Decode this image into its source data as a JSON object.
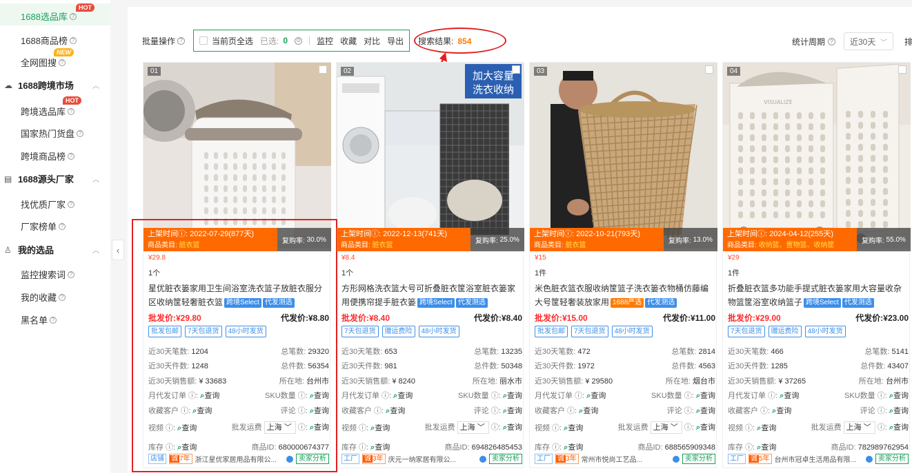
{
  "sidebar": {
    "items": [
      {
        "label": "1688选品库",
        "badge": "HOT",
        "active": true
      },
      {
        "label": "1688商品榜"
      },
      {
        "label": "全网图搜",
        "badge": "NEW"
      },
      {
        "group": "1688跨境市场"
      },
      {
        "label": "跨境选品库",
        "badge": "HOT"
      },
      {
        "label": "国家热门货盘"
      },
      {
        "label": "跨境商品榜"
      },
      {
        "group": "1688源头厂家"
      },
      {
        "label": "找优质厂家"
      },
      {
        "label": "厂家榜单"
      },
      {
        "group": "我的选品"
      },
      {
        "label": "监控搜索词"
      },
      {
        "label": "我的收藏"
      },
      {
        "label": "黑名单"
      }
    ]
  },
  "toolbar": {
    "batch_label": "批量操作",
    "select_all": "当前页全选",
    "selected_label": "已选:",
    "selected_count": "0",
    "monitor": "监控",
    "favorite": "收藏",
    "compare": "对比",
    "export": "导出",
    "search_result_label": "搜索结果:",
    "search_result_count": "854",
    "period_label": "统计周期",
    "period_value": "近30天",
    "more": "排"
  },
  "labels": {
    "listed_prefix": "上架时间",
    "category_prefix": "商品类目:",
    "repurchase_prefix": "复购率:",
    "wholesale_prefix": "批发价:",
    "dropship_prefix": "代发价:",
    "stat_30d_orders": "近30天笔数:",
    "stat_total_orders": "总笔数:",
    "stat_30d_pieces": "近30天件数:",
    "stat_total_pieces": "总件数:",
    "stat_30d_sales": "近30天销售额:",
    "stat_location": "所在地:",
    "monthly_orders": "月代发订单",
    "sku_count": "SKU数量",
    "fav_customers": "收藏客户",
    "reviews": "评论",
    "video": "视频",
    "shipping": "批发运费",
    "shipping_region": "上海",
    "stock": "库存",
    "product_id": "商品ID:",
    "query": "查询",
    "seller_analysis": "卖家分析"
  },
  "products": [
    {
      "no": "01",
      "listed": "2022-07-29(877天)",
      "category": "脏衣篮",
      "repurchase": "30.0%",
      "price_small": "¥29.8",
      "unit": "1个",
      "title": "星优脏衣篓家用卫生间浴室洗衣篮子放脏衣服分区收纳筐轻奢脏衣篮",
      "tags": [
        "跨境Select",
        "代发测选"
      ],
      "wholesale": "¥29.80",
      "dropship": "¥8.80",
      "chips": [
        "批发包邮",
        "7天包退货",
        "48小时发货"
      ],
      "orders_30d": "1204",
      "orders_total": "29320",
      "pieces_30d": "1248",
      "pieces_total": "56354",
      "sales_30d": "¥ 33683",
      "location": "台州市",
      "product_id": "680000674377",
      "shop_type": "店铺",
      "years": "7年",
      "company": "浙江星优家居用品有限公..."
    },
    {
      "no": "02",
      "listed": "2022-12-13(741天)",
      "category": "脏衣篮",
      "repurchase": "25.0%",
      "price_small": "¥8.4",
      "unit": "1个",
      "title": "方形网格洗衣篮大号可折叠脏衣筐浴室脏衣篓家用便携帘提手脏衣篓",
      "tags": [
        "跨境Select",
        "代发测选"
      ],
      "wholesale": "¥8.40",
      "dropship": "¥8.40",
      "chips": [
        "7天包退货",
        "赠运费险",
        "48小时发货"
      ],
      "orders_30d": "653",
      "orders_total": "13235",
      "pieces_30d": "981",
      "pieces_total": "50348",
      "sales_30d": "¥ 8240",
      "location": "丽水市",
      "product_id": "694826485453",
      "shop_type": "工厂",
      "years": "3年",
      "company": "庆元一纳家居有限公...",
      "overlay_text": "加大容量\n洗衣收纳"
    },
    {
      "no": "03",
      "listed": "2022-10-21(793天)",
      "category": "脏衣篮",
      "repurchase": "13.0%",
      "price_small": "¥15",
      "unit": "1件",
      "title": "米色脏衣篮衣服收纳筐篮子洗衣篓衣物桶仿藤编大号筐轻奢装放家用",
      "tags": [
        "1688严选",
        "代发测选"
      ],
      "wholesale": "¥15.00",
      "dropship": "¥11.00",
      "chips": [
        "批发包邮",
        "7天包退货",
        "48小时发货"
      ],
      "orders_30d": "472",
      "orders_total": "2814",
      "pieces_30d": "1972",
      "pieces_total": "4563",
      "sales_30d": "¥ 29580",
      "location": "烟台市",
      "product_id": "688565909348",
      "shop_type": "工厂",
      "years": "3年",
      "company": "常州市悦尚工艺品..."
    },
    {
      "no": "04",
      "listed": "2024-04-12(255天)",
      "category": "收纳篮、置物篮、收纳筐",
      "repurchase": "55.0%",
      "price_small": "¥29",
      "unit": "1件",
      "title": "折叠脏衣篮多功能手提式脏衣篓家用大容量收杂物篮筐浴室收纳篮子",
      "tags": [
        "跨境Select",
        "代发测选"
      ],
      "wholesale": "¥29.00",
      "dropship": "¥23.00",
      "chips": [
        "7天包退货",
        "赠运费险",
        "48小时发货"
      ],
      "orders_30d": "466",
      "orders_total": "5141",
      "pieces_30d": "1285",
      "pieces_total": "43407",
      "sales_30d": "¥ 37265",
      "location": "台州市",
      "product_id": "782989762954",
      "shop_type": "工厂",
      "years": "5年",
      "company": "台州市冠卓生活用品有限..."
    }
  ],
  "colors": {
    "accent": "#18a058",
    "orange": "#ff6a00",
    "price_red": "#ff2a2a",
    "annotation_red": "#e02020"
  }
}
